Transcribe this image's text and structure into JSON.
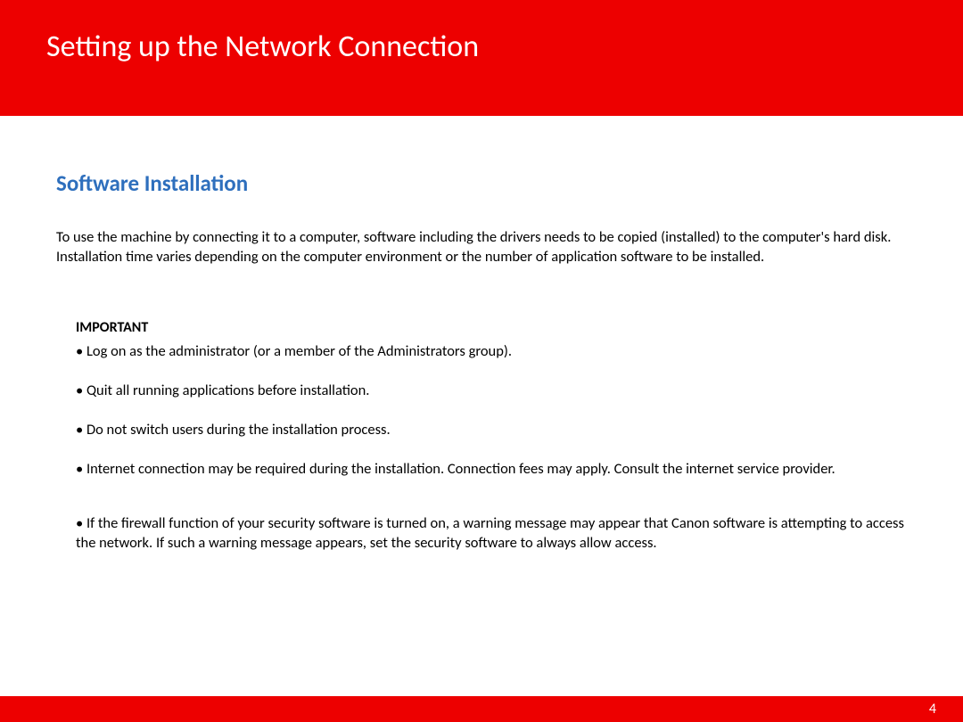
{
  "header": {
    "title": "Setting up the Network Connection"
  },
  "section": {
    "title": "Software Installation",
    "intro": "To use the machine by connecting it to a computer, software including the drivers needs to be copied (installed) to the computer's hard disk. Installation time varies depending on the computer environment or the number of application software to be installed."
  },
  "important": {
    "label": "IMPORTANT",
    "items": [
      "• Log on as the administrator (or a member of the Administrators group).",
      "• Quit all running applications before installation.",
      "• Do not switch users during the installation process.",
      "• Internet connection may be required during the installation. Connection fees may apply. Consult the internet service provider.",
      "• If the firewall function of your security software is turned on, a warning message may appear that Canon software is attempting to access the network. If such a warning message appears, set the security software to always allow access."
    ]
  },
  "footer": {
    "page": "4"
  }
}
